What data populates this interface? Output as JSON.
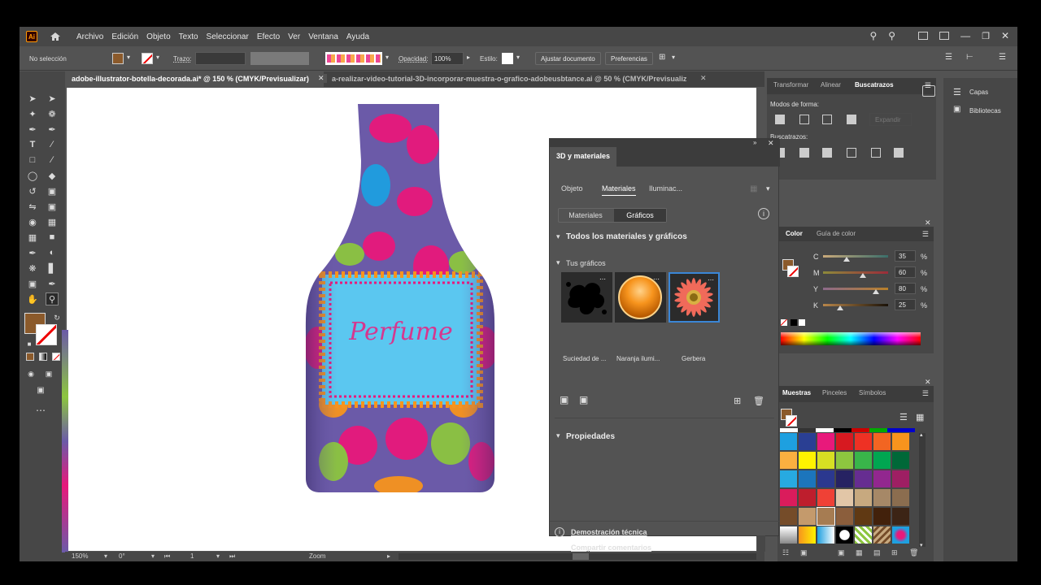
{
  "menubar": {
    "logo": "Ai",
    "items": [
      "Archivo",
      "Edición",
      "Objeto",
      "Texto",
      "Seleccionar",
      "Efecto",
      "Ver",
      "Ventana",
      "Ayuda"
    ]
  },
  "control": {
    "selection": "No selección",
    "stroke_label": "Trazo:",
    "opacity_label": "Opacidad:",
    "opacity_value": "100%",
    "style_label": "Estilo:",
    "adjust_button": "Ajustar documento",
    "preferences_button": "Preferencias"
  },
  "tabs": [
    {
      "label": "adobe-illustrator-botella-decorada.ai* @ 150 % (CMYK/Previsualizar)"
    },
    {
      "label": "a-realizar-video-tutorial-3D-incorporar-muestra-o-grafico-adobeusbtance.ai @ 50 % (CMYK/Previsualiz"
    }
  ],
  "artwork": {
    "label_text": "Perfume"
  },
  "pathfinder": {
    "tabs": [
      "Transformar",
      "Alinear",
      "Buscatrazos"
    ],
    "shape_modes": "Modos de forma:",
    "expand": "Expandir",
    "pathfinders": "Buscatrazos:"
  },
  "right_dock": {
    "layers": "Capas",
    "libraries": "Bibliotecas"
  },
  "color_panel": {
    "tabs": [
      "Color",
      "Guía de color"
    ],
    "channels": [
      {
        "name": "C",
        "value": "35",
        "unit": "%",
        "fraction": 0.35
      },
      {
        "name": "M",
        "value": "60",
        "unit": "%",
        "fraction": 0.6
      },
      {
        "name": "Y",
        "value": "80",
        "unit": "%",
        "fraction": 0.8
      },
      {
        "name": "K",
        "value": "25",
        "unit": "%",
        "fraction": 0.25
      }
    ],
    "fill_color": "#8b5a2b"
  },
  "swatches_panel": {
    "tabs": [
      "Muestras",
      "Pinceles",
      "Símbolos"
    ],
    "colors": [
      "#1ea0e0",
      "#2a3f93",
      "#e8197b",
      "#d71920",
      "#ee3124",
      "#f26522",
      "#f7941d",
      "#fbb040",
      "#fff200",
      "#d7df23",
      "#8dc63f",
      "#39b54a",
      "#00a651",
      "#006838",
      "#27aae1",
      "#1c75bc",
      "#2b388f",
      "#262262",
      "#662d91",
      "#92278f",
      "#9e1f63",
      "#da1c5c",
      "#be1e2d",
      "#ef4136",
      "#e2c6a7",
      "#c7a97f",
      "#a68867",
      "#8b6d4f",
      "#754c29",
      "#c49a6c",
      "#a67c52",
      "#8b5e3c",
      "#603913",
      "#42210b",
      "#3c2415"
    ]
  },
  "materials_panel": {
    "title": "3D y materiales",
    "tabs": [
      "Objeto",
      "Materiales",
      "Iluminac..."
    ],
    "subtabs": [
      "Materiales",
      "Gráficos"
    ],
    "all_section": "Todos los materiales y gráficos",
    "your_graphics": "Tus gráficos",
    "graphics": [
      {
        "label": "Suciedad de ..."
      },
      {
        "label": "Naranja ilumi..."
      },
      {
        "label": "Gerbera"
      }
    ],
    "properties": "Propiedades",
    "tech_demo": "Demostración técnica",
    "share": "Compartir comentarios"
  },
  "status": {
    "zoom": "150%",
    "rotation": "0°",
    "artboard": "1",
    "mode": "Zoom"
  }
}
